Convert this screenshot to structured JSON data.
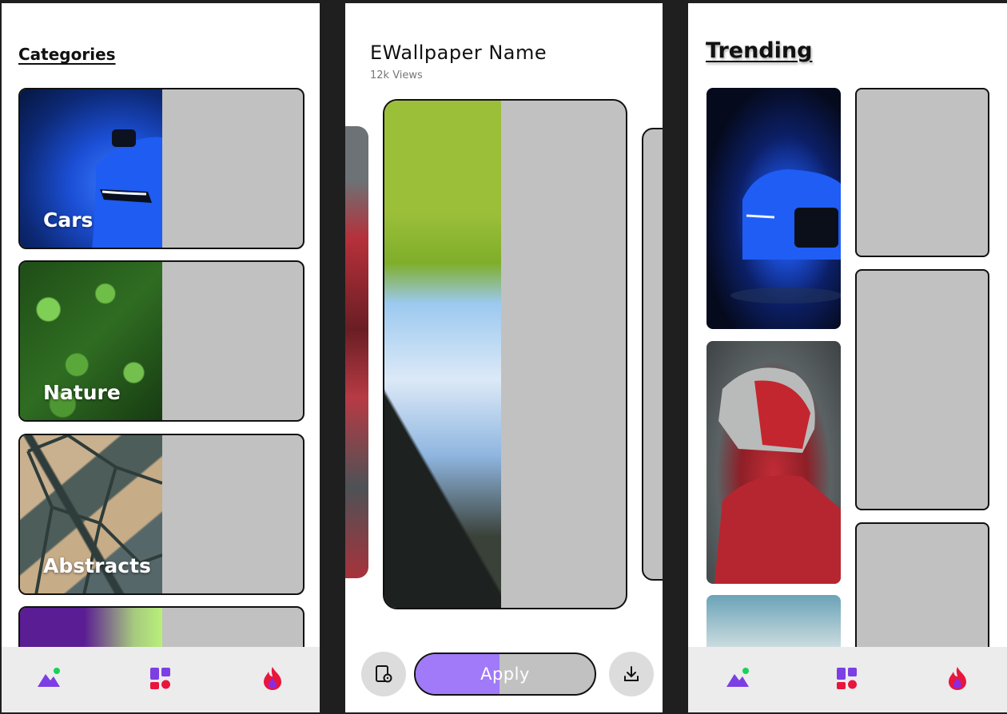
{
  "categories_screen": {
    "heading": "Categories",
    "cards": [
      {
        "label": "Cars"
      },
      {
        "label": "Nature"
      },
      {
        "label": "Abstracts"
      },
      {
        "label": ""
      }
    ],
    "nav": [
      "mountain-icon",
      "grid-icon",
      "flame-icon"
    ]
  },
  "detail_screen": {
    "title": "EWallpaper Name",
    "views": "12k Views",
    "apply_label": "Apply",
    "apply_progress": 0.47
  },
  "trending_screen": {
    "heading": "Trending",
    "nav": [
      "mountain-icon",
      "grid-icon",
      "flame-icon"
    ]
  },
  "colors": {
    "accent_purple": "#a07af9",
    "placeholder_grey": "#c1c1c1",
    "nav_bg": "#ececec",
    "flame_red": "#e8163d"
  }
}
